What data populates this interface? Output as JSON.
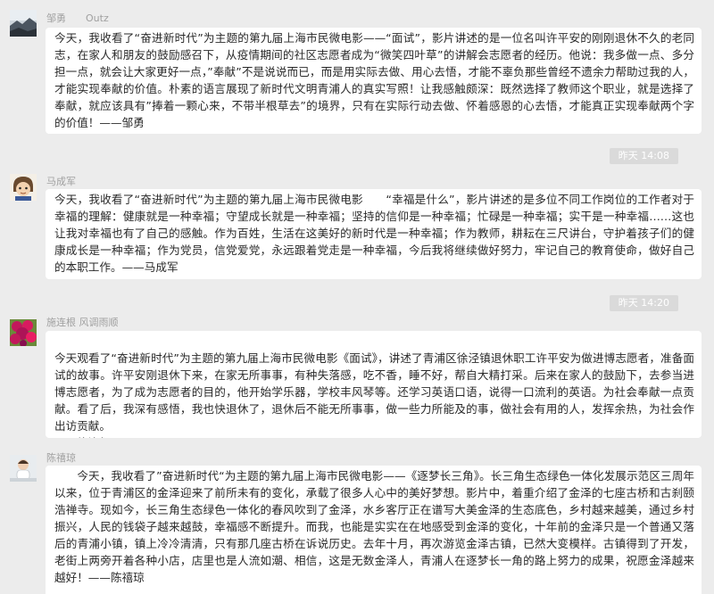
{
  "messages": [
    {
      "sender": "邹勇　　Outz",
      "avatar_icon": "landscape-avatar-icon",
      "text": "今天，我收看了“奋进新时代”为主题的第九届上海市民微电影——“面试”，影片讲述的是一位名叫许平安的刚刚退休不久的老同志，在家人和朋友的鼓励感召下，从疫情期间的社区志愿者成为“微笑四叶草”的讲解会志愿者的经历。他说：我多做一点、多分担一点，就会让大家更好一点，”奉献”不是说说而已，而是用实际去做、用心去悟，才能不辜负那些曾经不遗余力帮助过我的人，才能实现奉献的价值。朴素的语言展现了新时代文明青浦人的真实写照！让我感触颇深：既然选择了教师这个职业，就是选择了奉献，就应该具有”捧着一颗心来，不带半根草去”的境界，只有在实际行动去做、怀着感恩的心去悟，才能真正实现奉献两个字的价值！——邹勇"
    },
    {
      "time": "昨天 14:08",
      "sender": "马成军",
      "avatar_icon": "cartoon-avatar-icon",
      "text": "今天，我收看了“奋进新时代”为主题的第九届上海市民微电影　　“幸福是什么”，影片讲述的是多位不同工作岗位的工作者对于幸福的理解：健康就是一种幸福；守望成长就是一种幸福；坚持的信仰是一种幸福；忙碌是一种幸福；实干是一种幸福……这也让我对幸福也有了自己的感触。作为百姓，生活在这美好的新时代是一种幸福；作为教师，耕耘在三尺讲台，守护着孩子们的健康成长是一种幸福；作为党员，信党爱党，永远跟着党走是一种幸福，今后我将继续做好努力，牢记自己的教育使命，做好自己的本职工作。——马成军"
    },
    {
      "time": "昨天 14:20",
      "sender": "施连根 风调雨顺",
      "avatar_icon": "flower-avatar-icon",
      "text": "今天观看了“奋进新时代”为主题的第九届上海市民微电影《面试》，讲述了青浦区徐泾镇退休职工许平安为做进博志愿者，准备面试的故事。许平安刚退休下来，在家无所事事，有种失落感，吃不香，睡不好，帮自大精打采。后来在家人的鼓励下，去参当进博志愿者，为了成为志愿者的目的，他开始学乐器，学校丰风琴等。还学习英语口语，说得一口流利的英语。为社会奉献一点贡献。看了后，我深有感悟，我也快退休了，退休后不能无所事事，做一些力所能及的事，做社会有用的人，发挥余热，为社会作出访贡献。\n——施连根"
    },
    {
      "sender": "陈禧琼",
      "avatar_icon": "child-photo-avatar-icon",
      "text": "　　今天，我收看了”奋进新时代“为主题的第九届上海市民微电影——《逐梦长三角》。长三角生态绿色一体化发展示范区三周年以来，位于青浦区的金泽迎来了前所未有的变化，承载了很多人心中的美好梦想。影片中，着重介绍了金泽的七座古桥和古刹颐浩禅寺。现如今，长三角生态绿色一体化的春风吹到了金泽，水乡客厅正在谱写大美金泽的生态底色，乡村越来越美，通过乡村振兴，人民的钱袋子越来越鼓，幸福感不断提升。而我，也能是实实在在地感受到金泽的变化，十年前的金泽只是一个普通又落后的青浦小镇，镇上冷冷清清，只有那几座古桥在诉说历史。去年十月，再次游览金泽古镇，已然大变模样。古镇得到了开发，老街上两旁开着各种小店，店里也是人流如潮、相信，这是无数金泽人，青浦人在逐梦长一角的路上努力的成果，祝愿金泽越来越好！——陈禧琼"
    }
  ],
  "colors": {
    "background": "#ececec",
    "bubble": "#ffffff",
    "time_badge": "#dadada",
    "sender_text": "#a0a0a0"
  }
}
